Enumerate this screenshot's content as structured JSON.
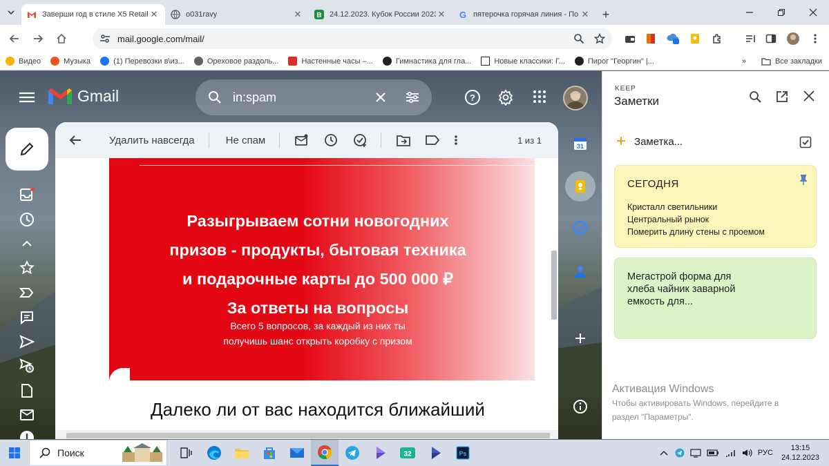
{
  "browser": {
    "tabs": [
      {
        "title": "Заверши год в стиле X5 Retail",
        "active": true,
        "favicon": "gmail-icon"
      },
      {
        "title": "o031ravy",
        "active": false,
        "favicon": "globe-icon"
      },
      {
        "title": "24.12.2023. Кубок России 2023",
        "active": false,
        "favicon": "green-b-icon"
      },
      {
        "title": "пятерочка горячая линия - По",
        "active": false,
        "favicon": "google-icon"
      }
    ],
    "address": "mail.google.com/mail/",
    "bookmarks": [
      {
        "label": "Видео",
        "color": "#f4b400"
      },
      {
        "label": "Музыка",
        "color": "#f4511e"
      },
      {
        "label": "(1) Перевозки в\\из...",
        "color": "#1877f2"
      },
      {
        "label": "Ореховое раздоль...",
        "color": "#5f6368"
      },
      {
        "label": "Настенные часы –...",
        "color": "#d93025"
      },
      {
        "label": "Гимнастика для гла...",
        "color": "#202124"
      },
      {
        "label": "Новые классики: Г...",
        "color": "#202124"
      },
      {
        "label": "Пирог \"Георгин\" |...",
        "color": "#202124"
      }
    ],
    "all_bookmarks": "Все закладки"
  },
  "gmail": {
    "logo_text": "Gmail",
    "search_query": "in:spam",
    "toolbar": {
      "delete_forever": "Удалить навсегда",
      "not_spam": "Не спам",
      "count": "1 из 1"
    },
    "banner": {
      "headline": [
        "Разыгрываем сотни новогодних",
        "призов - продукты, бытовая техника",
        "и подарочные карты до 500 000 ₽",
        "За ответы на вопросы"
      ],
      "sub": [
        "Всего 5 вопросов, за каждый из них ты",
        "получишь шанс открыть коробку с призом"
      ]
    },
    "question": "Далеко ли от вас находится ближайший"
  },
  "keep": {
    "caption": "KEEP",
    "title": "Заметки",
    "take_note": "Заметка...",
    "notes": [
      {
        "title": "СЕГОДНЯ",
        "lines": [
          "Кристалл светильники",
          "Центральный рынок",
          "Померить длину стены с проемом"
        ],
        "color": "#fcf5ba",
        "pinned": true
      },
      {
        "title": "",
        "lines": [
          "Мегастрой  форма для",
          "хлеба чайник заварной",
          "емкость для..."
        ],
        "color": "#dcf3c8",
        "pinned": false
      }
    ]
  },
  "watermark": {
    "title": "Активация Windows",
    "lines": [
      "Чтобы активировать Windows, перейдите в",
      "раздел \"Параметры\"."
    ]
  },
  "taskbar": {
    "search": "Поиск",
    "lang": "РУС",
    "time": "13:15",
    "date": "24.12.2023"
  }
}
